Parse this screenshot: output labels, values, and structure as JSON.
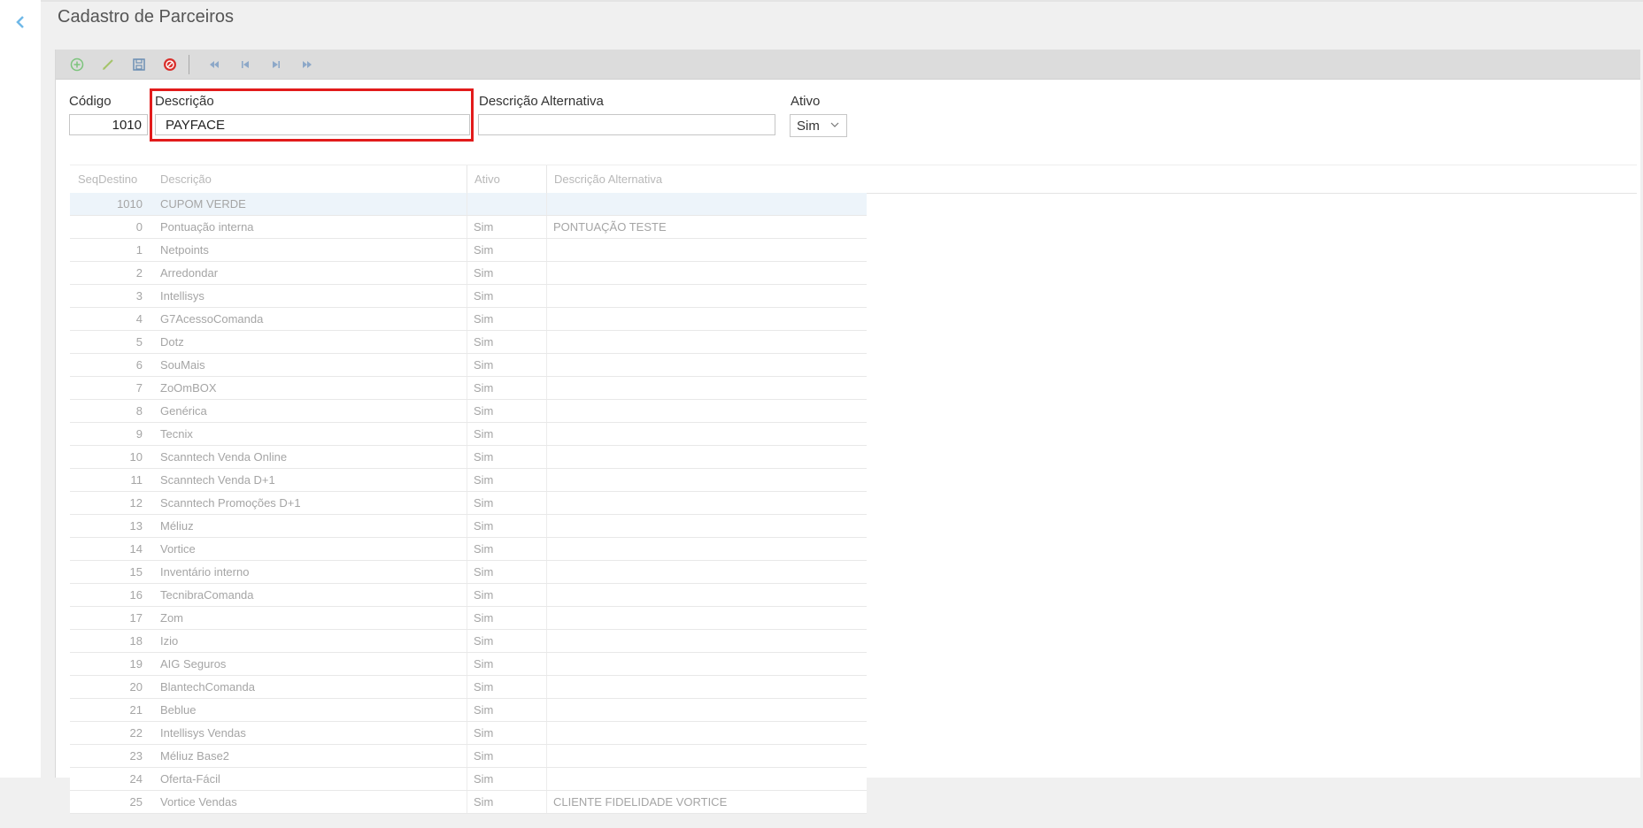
{
  "header": {
    "title": "Cadastro de Parceiros"
  },
  "form": {
    "codigo_label": "Código",
    "codigo_value": "1010",
    "descricao_label": "Descrição",
    "descricao_value": "PAYFACE",
    "desc_alt_label": "Descrição Alternativa",
    "desc_alt_value": "",
    "ativo_label": "Ativo",
    "ativo_value": "Sim"
  },
  "grid": {
    "columns": [
      "SeqDestino",
      "Descrição",
      "Ativo",
      "Descrição Alternativa"
    ],
    "rows": [
      {
        "seq": "1010",
        "descricao": "CUPOM VERDE",
        "ativo": "",
        "alt": "",
        "selected": true
      },
      {
        "seq": "0",
        "descricao": "Pontuação interna",
        "ativo": "Sim",
        "alt": "PONTUAÇÃO TESTE"
      },
      {
        "seq": "1",
        "descricao": "Netpoints",
        "ativo": "Sim",
        "alt": ""
      },
      {
        "seq": "2",
        "descricao": "Arredondar",
        "ativo": "Sim",
        "alt": ""
      },
      {
        "seq": "3",
        "descricao": "Intellisys",
        "ativo": "Sim",
        "alt": ""
      },
      {
        "seq": "4",
        "descricao": "G7AcessoComanda",
        "ativo": "Sim",
        "alt": ""
      },
      {
        "seq": "5",
        "descricao": "Dotz",
        "ativo": "Sim",
        "alt": ""
      },
      {
        "seq": "6",
        "descricao": "SouMais",
        "ativo": "Sim",
        "alt": ""
      },
      {
        "seq": "7",
        "descricao": "ZoOmBOX",
        "ativo": "Sim",
        "alt": ""
      },
      {
        "seq": "8",
        "descricao": "Genérica",
        "ativo": "Sim",
        "alt": ""
      },
      {
        "seq": "9",
        "descricao": "Tecnix",
        "ativo": "Sim",
        "alt": ""
      },
      {
        "seq": "10",
        "descricao": "Scanntech Venda Online",
        "ativo": "Sim",
        "alt": ""
      },
      {
        "seq": "11",
        "descricao": "Scanntech Venda D+1",
        "ativo": "Sim",
        "alt": ""
      },
      {
        "seq": "12",
        "descricao": "Scanntech Promoções D+1",
        "ativo": "Sim",
        "alt": ""
      },
      {
        "seq": "13",
        "descricao": "Méliuz",
        "ativo": "Sim",
        "alt": ""
      },
      {
        "seq": "14",
        "descricao": "Vortice",
        "ativo": "Sim",
        "alt": ""
      },
      {
        "seq": "15",
        "descricao": "Inventário interno",
        "ativo": "Sim",
        "alt": ""
      },
      {
        "seq": "16",
        "descricao": "TecnibraComanda",
        "ativo": "Sim",
        "alt": ""
      },
      {
        "seq": "17",
        "descricao": "Zom",
        "ativo": "Sim",
        "alt": ""
      },
      {
        "seq": "18",
        "descricao": "Izio",
        "ativo": "Sim",
        "alt": ""
      },
      {
        "seq": "19",
        "descricao": "AIG Seguros",
        "ativo": "Sim",
        "alt": ""
      },
      {
        "seq": "20",
        "descricao": "BlantechComanda",
        "ativo": "Sim",
        "alt": ""
      },
      {
        "seq": "21",
        "descricao": "Beblue",
        "ativo": "Sim",
        "alt": ""
      },
      {
        "seq": "22",
        "descricao": "Intellisys Vendas",
        "ativo": "Sim",
        "alt": ""
      },
      {
        "seq": "23",
        "descricao": "Méliuz Base2",
        "ativo": "Sim",
        "alt": ""
      },
      {
        "seq": "24",
        "descricao": "Oferta-Fácil",
        "ativo": "Sim",
        "alt": ""
      },
      {
        "seq": "25",
        "descricao": "Vortice Vendas",
        "ativo": "Sim",
        "alt": "CLIENTE FIDELIDADE VORTICE"
      }
    ]
  },
  "icons": {
    "back": "chevron-left-icon",
    "toolbar": [
      "add-icon",
      "edit-icon",
      "save-icon",
      "cancel-icon",
      "first-record-icon",
      "previous-record-icon",
      "next-record-icon",
      "last-record-icon"
    ]
  },
  "colors": {
    "add": "#7cc47c",
    "edit": "#a5c46a",
    "save": "#6d8fb3",
    "cancel": "#d9302c",
    "nav": "#8da8c8",
    "highlight": "#e21b1b",
    "selected_row": "#edf4fa",
    "back_chevron": "#6fb8e8"
  }
}
